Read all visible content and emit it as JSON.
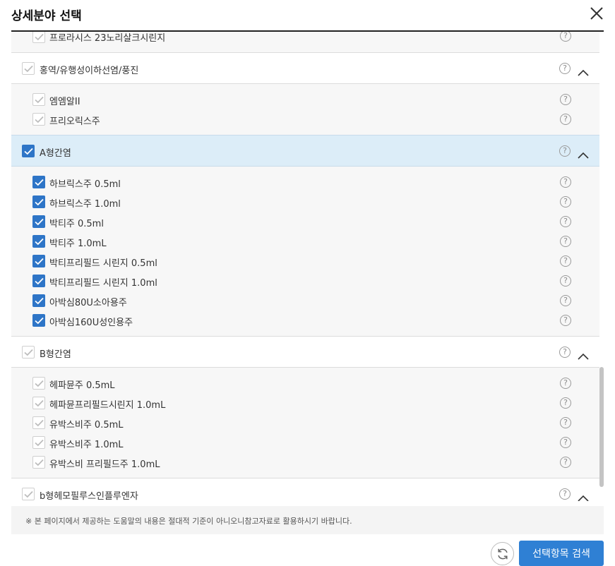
{
  "header": {
    "title": "상세분야 선택"
  },
  "partial_top_item": {
    "label": "프로라시스 23노리살크시린지"
  },
  "groups": [
    {
      "label": "홍역/유행성이하선염/풍진",
      "checked": false,
      "items": [
        {
          "label": "엠엠알II",
          "checked": false
        },
        {
          "label": "프리오릭스주",
          "checked": false
        }
      ]
    },
    {
      "label": "A형간염",
      "checked": true,
      "items": [
        {
          "label": "하브릭스주 0.5ml",
          "checked": true
        },
        {
          "label": "하브릭스주 1.0ml",
          "checked": true
        },
        {
          "label": "박티주 0.5ml",
          "checked": true
        },
        {
          "label": "박티주 1.0mL",
          "checked": true
        },
        {
          "label": "박티프리필드 시린지 0.5ml",
          "checked": true
        },
        {
          "label": "박티프리필드 시린지 1.0ml",
          "checked": true
        },
        {
          "label": "아박심80U소아용주",
          "checked": true
        },
        {
          "label": "아박심160U성인용주",
          "checked": true
        }
      ]
    },
    {
      "label": "B형간염",
      "checked": false,
      "items": [
        {
          "label": "헤파뮨주 0.5mL",
          "checked": false
        },
        {
          "label": "헤파뮨프리필드시린지 1.0mL",
          "checked": false
        },
        {
          "label": "유박스비주 0.5mL",
          "checked": false
        },
        {
          "label": "유박스비주 1.0mL",
          "checked": false
        },
        {
          "label": "유박스비 프리필드주 1.0mL",
          "checked": false
        }
      ]
    },
    {
      "label": "b형헤모필루스인플루엔자",
      "checked": false,
      "items": []
    }
  ],
  "help_glyph": "?",
  "notice": "※ 본 페이지에서 제공하는 도움말의 내용은 절대적 기준이 아니오니참고자료로 활용하시기 바랍니다.",
  "buttons": {
    "search_label": "선택항목 검색"
  },
  "colors": {
    "accent": "#2f80d4",
    "checkbox_checked": "#2e75c7",
    "active_group_bg": "#dcedf8"
  },
  "icons": {
    "close": "close-icon",
    "help": "help-icon",
    "collapse": "chevron-up-icon",
    "reset": "refresh-icon",
    "check": "checkmark-icon"
  }
}
